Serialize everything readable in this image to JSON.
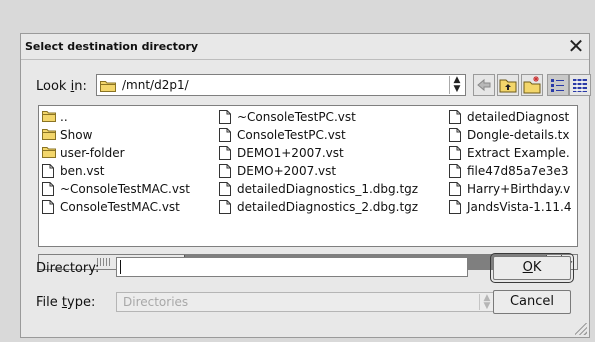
{
  "dialog": {
    "title": "Select destination directory",
    "close_icon": "close-icon"
  },
  "lookin": {
    "label_pre": "Look ",
    "label_accel": "i",
    "label_post": "n:",
    "value": "/mnt/d2p1/"
  },
  "toolbar": {
    "buttons": [
      "back-icon",
      "parent-folder-icon",
      "new-folder-icon",
      "list-view-icon",
      "detail-view-icon"
    ]
  },
  "files": {
    "columns": [
      [
        {
          "name": "..",
          "type": "folder"
        },
        {
          "name": "Show",
          "type": "folder"
        },
        {
          "name": "user-folder",
          "type": "folder"
        },
        {
          "name": "ben.vst",
          "type": "file"
        },
        {
          "name": "~ConsoleTestMAC.vst",
          "type": "file"
        },
        {
          "name": "ConsoleTestMAC.vst",
          "type": "file"
        }
      ],
      [
        {
          "name": "~ConsoleTestPC.vst",
          "type": "file"
        },
        {
          "name": "ConsoleTestPC.vst",
          "type": "file"
        },
        {
          "name": "DEMO1+2007.vst",
          "type": "file"
        },
        {
          "name": "DEMO+2007.vst",
          "type": "file"
        },
        {
          "name": "detailedDiagnostics_1.dbg.tgz",
          "type": "file"
        },
        {
          "name": "detailedDiagnostics_2.dbg.tgz",
          "type": "file"
        }
      ],
      [
        {
          "name": "detailedDiagnost",
          "type": "file"
        },
        {
          "name": "Dongle-details.tx",
          "type": "file"
        },
        {
          "name": "Extract Example.",
          "type": "file"
        },
        {
          "name": "file47d85a7e3e3",
          "type": "file"
        },
        {
          "name": "Harry+Birthday.v",
          "type": "file"
        },
        {
          "name": "JandsVista-1.11.4",
          "type": "file"
        }
      ]
    ]
  },
  "directory": {
    "label_pre": "Directory:",
    "value": ""
  },
  "filetype": {
    "label_pre": "File ",
    "label_accel": "t",
    "label_post": "ype:",
    "value": "Directories"
  },
  "buttons": {
    "ok_accel": "O",
    "ok_post": "K",
    "cancel": "Cancel"
  }
}
